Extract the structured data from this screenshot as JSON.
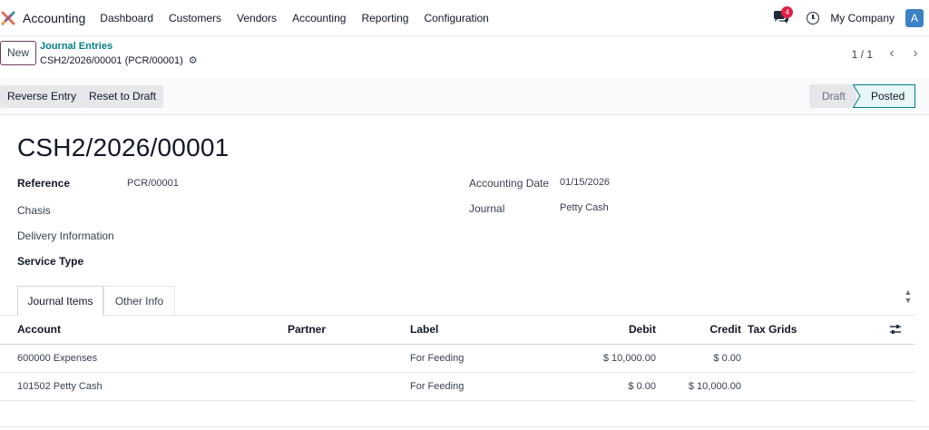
{
  "navbar": {
    "app_name": "Accounting",
    "menu": [
      "Dashboard",
      "Customers",
      "Vendors",
      "Accounting",
      "Reporting",
      "Configuration"
    ],
    "message_count": "4",
    "company": "My Company",
    "avatar_initial": "A"
  },
  "control": {
    "new_label": "New",
    "breadcrumb_parent": "Journal Entries",
    "breadcrumb_current": "CSH2/2026/00001 (PCR/00001)",
    "pager": "1 / 1"
  },
  "actions": {
    "reverse": "Reverse Entry",
    "reset": "Reset to Draft"
  },
  "status": {
    "steps": [
      "Draft",
      "Posted"
    ],
    "current": "Posted"
  },
  "form": {
    "title": "CSH2/2026/00001",
    "reference_label": "Reference",
    "reference_value": "PCR/00001",
    "chasis_label": "Chasis",
    "delivery_label": "Delivery Information",
    "service_label": "Service Type",
    "accounting_date_label": "Accounting Date",
    "accounting_date_value": "01/15/2026",
    "journal_label": "Journal",
    "journal_value": "Petty Cash"
  },
  "tabs": [
    "Journal Items",
    "Other Info"
  ],
  "table": {
    "columns": [
      "Account",
      "Partner",
      "Label",
      "Debit",
      "Credit",
      "Tax Grids"
    ],
    "rows": [
      {
        "account": "600000 Expenses",
        "partner": "",
        "label": "For Feeding",
        "debit": "$ 10,000.00",
        "credit": "$ 0.00",
        "tax_grids": ""
      },
      {
        "account": "101502 Petty Cash",
        "partner": "",
        "label": "For Feeding",
        "debit": "$ 0.00",
        "credit": "$ 10,000.00",
        "tax_grids": ""
      }
    ]
  },
  "icons": {
    "logo": "odoo-accounting-logo",
    "messages": "chat-icon",
    "activity": "clock-icon",
    "record_settings": "gear-icon",
    "column_settings": "sliders-icon"
  },
  "colors": {
    "accent": "#017e84",
    "primary": "#6b3b5d",
    "badge": "#e11d48",
    "status_active": "#e6f7f7"
  }
}
